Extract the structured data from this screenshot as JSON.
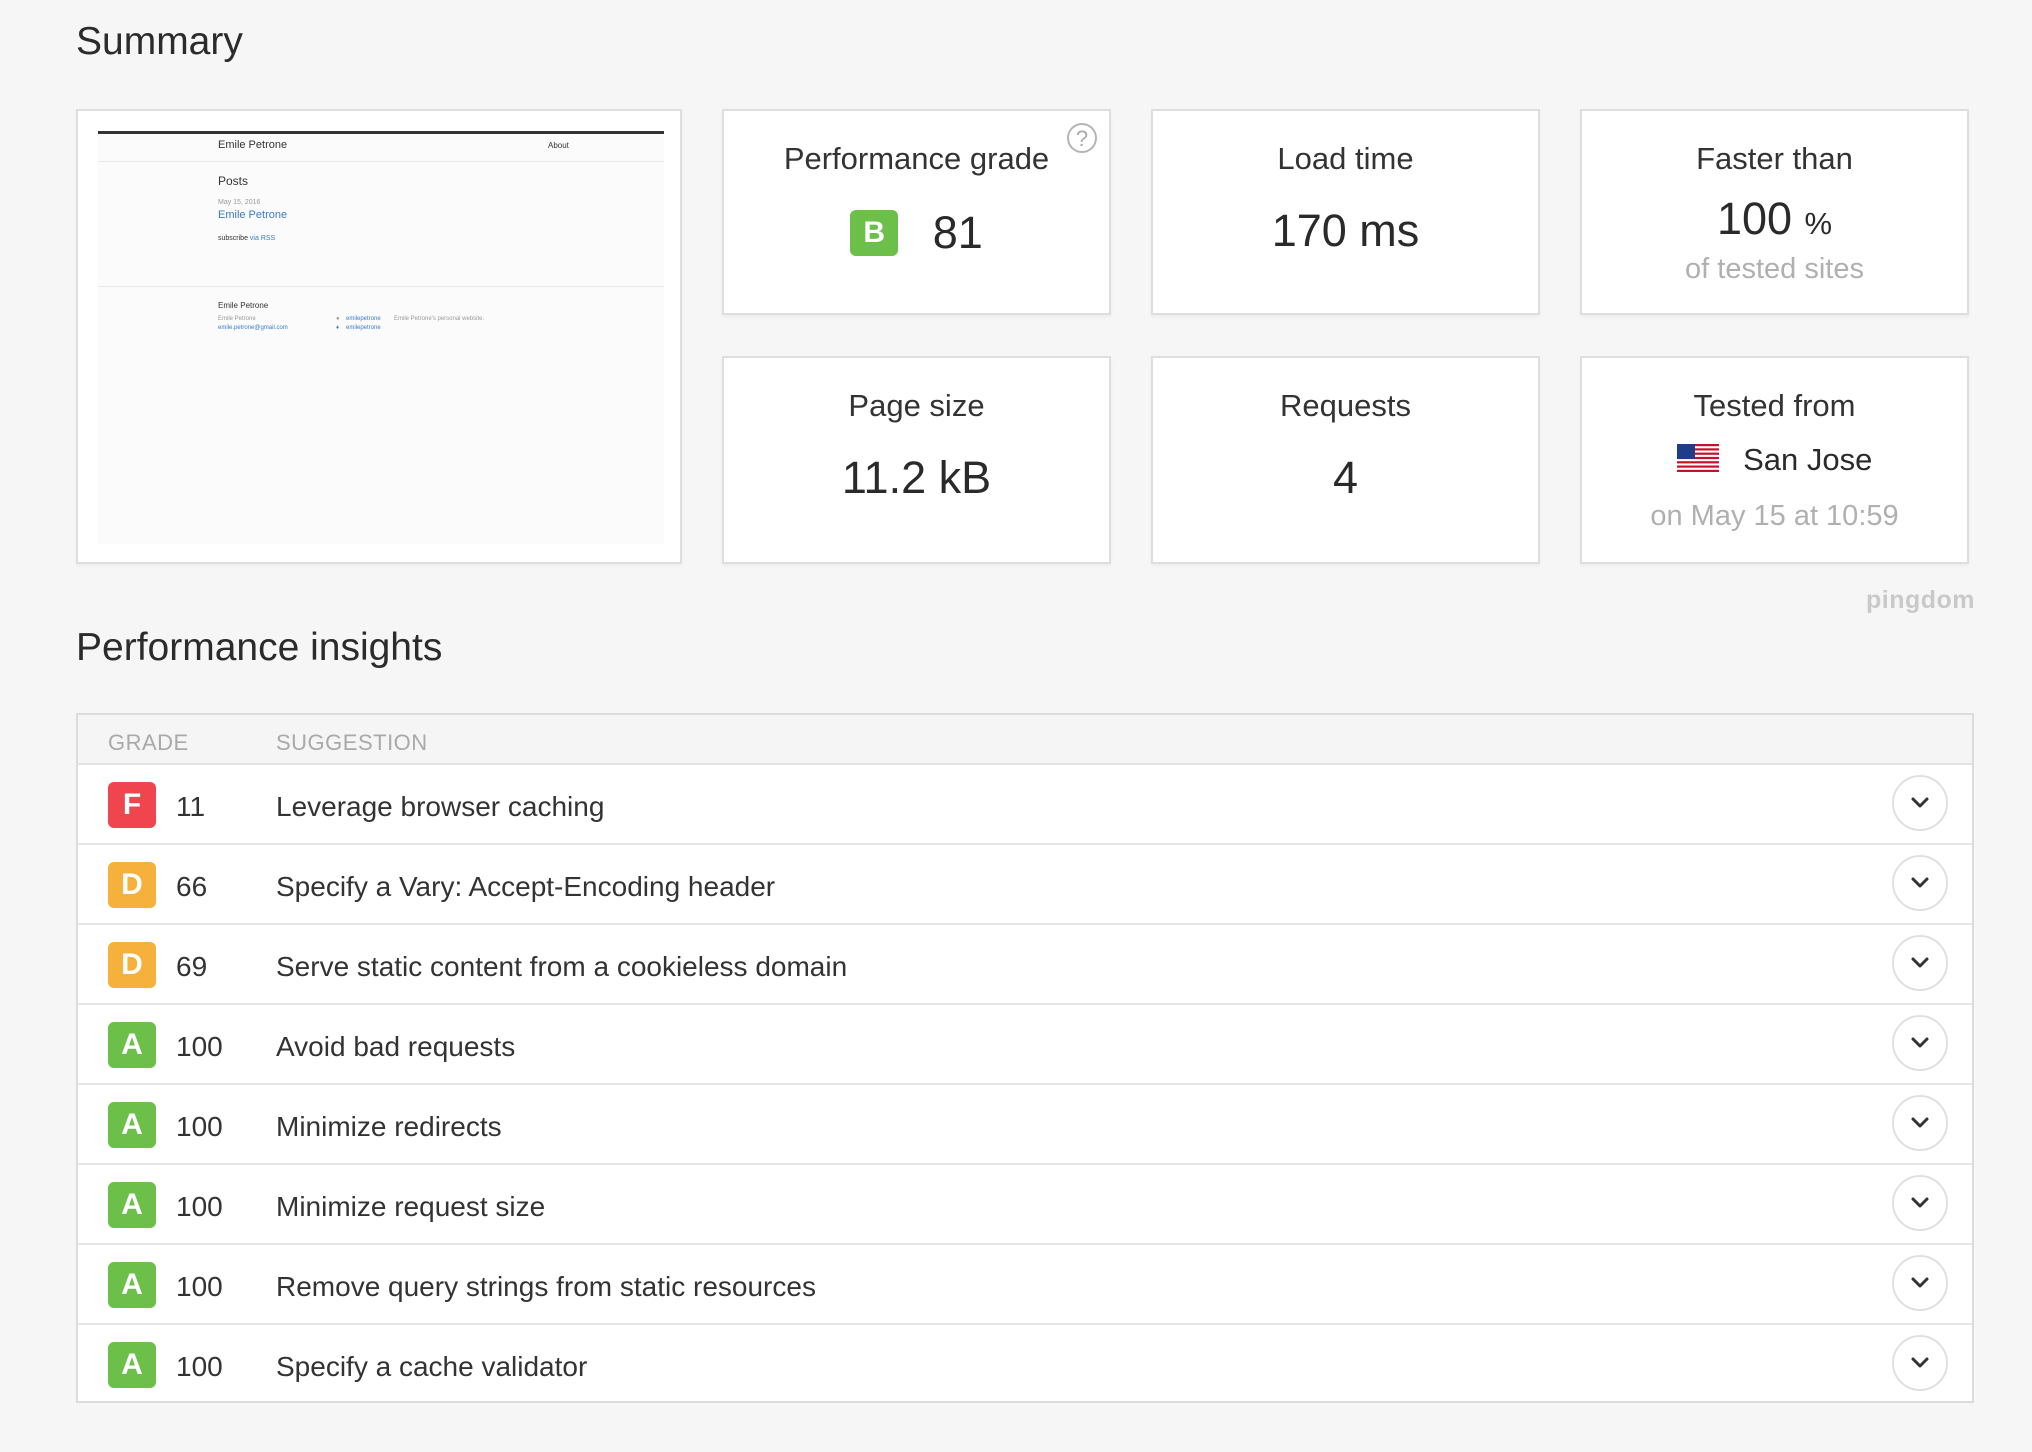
{
  "summary": {
    "title": "Summary",
    "thumbnail": {
      "site_name": "Emile Petrone",
      "nav_about": "About",
      "posts_heading": "Posts",
      "post_date": "May 15, 2016",
      "post_title": "Emile Petrone",
      "subscribe_text": "subscribe",
      "subscribe_link": "via RSS",
      "footer_name": "Emile Petrone",
      "footer_name_small": "Emile Petrone",
      "footer_email": "emile.petrone@gmail.com",
      "footer_github": "emilepetrone",
      "footer_twitter": "emilepetrone",
      "footer_description": "Emile Petrone's personal website."
    },
    "performance_grade": {
      "label": "Performance grade",
      "grade": "B",
      "score": "81",
      "help": "?"
    },
    "load_time": {
      "label": "Load time",
      "value": "170 ms"
    },
    "faster_than": {
      "label": "Faster than",
      "value": "100",
      "unit": "%",
      "sub": "of tested sites"
    },
    "page_size": {
      "label": "Page size",
      "value": "11.2 kB"
    },
    "requests": {
      "label": "Requests",
      "value": "4"
    },
    "tested_from": {
      "label": "Tested from",
      "location": "San Jose",
      "flag": "us-flag-icon",
      "sub": "on May 15 at 10:59"
    },
    "brand": "pingdom"
  },
  "insights": {
    "title": "Performance insights",
    "columns": {
      "grade": "GRADE",
      "suggestion": "SUGGESTION"
    },
    "rows": [
      {
        "grade": "F",
        "score": "11",
        "suggestion": "Leverage browser caching"
      },
      {
        "grade": "D",
        "score": "66",
        "suggestion": "Specify a Vary: Accept-Encoding header"
      },
      {
        "grade": "D",
        "score": "69",
        "suggestion": "Serve static content from a cookieless domain"
      },
      {
        "grade": "A",
        "score": "100",
        "suggestion": "Avoid bad requests"
      },
      {
        "grade": "A",
        "score": "100",
        "suggestion": "Minimize redirects"
      },
      {
        "grade": "A",
        "score": "100",
        "suggestion": "Minimize request size"
      },
      {
        "grade": "A",
        "score": "100",
        "suggestion": "Remove query strings from static resources"
      },
      {
        "grade": "A",
        "score": "100",
        "suggestion": "Specify a cache validator"
      }
    ]
  },
  "colors": {
    "grade_A": "#6cc04a",
    "grade_B": "#6cc04a",
    "grade_D": "#f6b03c",
    "grade_F": "#f0444e"
  }
}
